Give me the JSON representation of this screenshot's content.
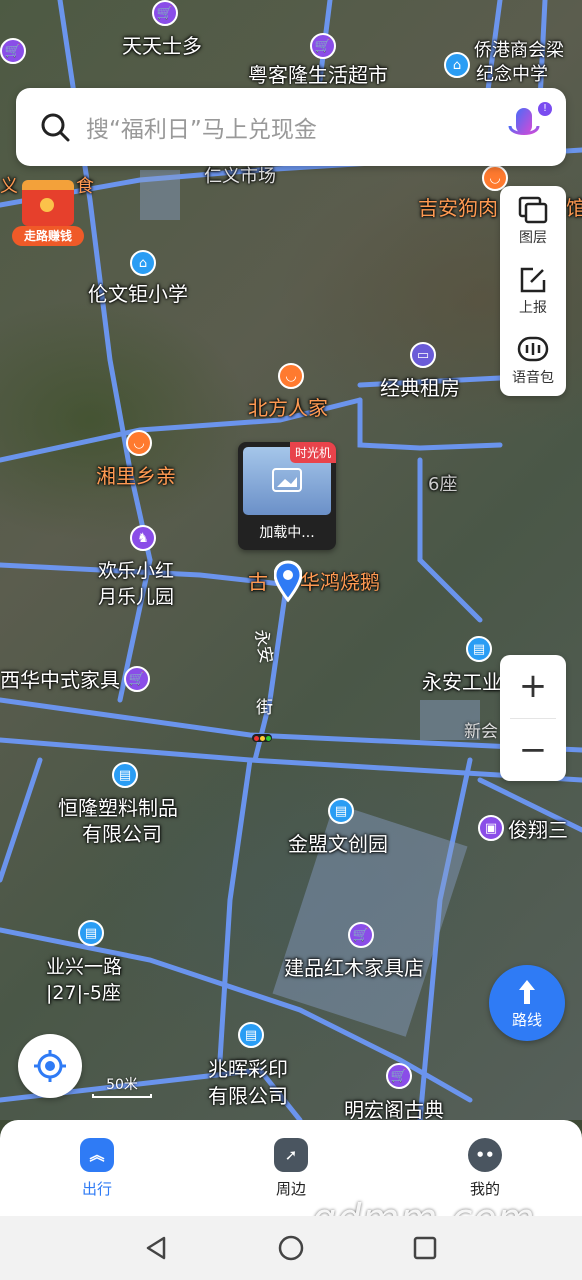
{
  "search": {
    "placeholder": "搜“福利日”马上兑现金"
  },
  "side_tools": [
    {
      "label": "图层",
      "icon": "layers-icon"
    },
    {
      "label": "上报",
      "icon": "report-edit-icon"
    },
    {
      "label": "语音包",
      "icon": "voice-pack-icon"
    }
  ],
  "zoom": {
    "in": "+",
    "out": "−"
  },
  "route_button": {
    "label": "路线"
  },
  "promo": {
    "label": "走路赚钱"
  },
  "timelapse": {
    "tag": "时光机",
    "status": "加载中..."
  },
  "scale": {
    "label": "50米"
  },
  "map_labels": {
    "l1": "天天士多",
    "l2": "粤客隆生活超市",
    "l3": "侨港商会梁",
    "l4": "纪念中学",
    "l5": "仁义市场",
    "l6": "义",
    "l7": "吉安狗肉",
    "l8": "伦文钜小学",
    "l9": "经典租房",
    "l10": "北方人家",
    "l11": "湘里乡亲",
    "l12": "6座",
    "l13": "欢乐小红",
    "l14": "月乐儿园",
    "l15": "古",
    "l16": "华鸿烧鹅",
    "l17": "永安",
    "l18": "街",
    "l19": "西华中式家具",
    "l20": "永安工业",
    "l21": "新会",
    "l22": "恒隆塑料制品",
    "l23": "有限公司",
    "l24": "俊翔三",
    "l25": "金盟文创园",
    "l26": "业兴一路",
    "l27": "|27|-5座",
    "l28": "建品红木家具店",
    "l29": "兆晖彩印",
    "l30": "有限公司",
    "l31": "明宏阁古典",
    "l32": "食",
    "l33": "馆"
  },
  "bottom_nav": [
    {
      "label": "出行",
      "active": true
    },
    {
      "label": "周边",
      "active": false
    },
    {
      "label": "我的",
      "active": false
    }
  ],
  "watermark": "gdmm.com",
  "colors": {
    "accent": "#2f7bf5",
    "road": "#6e9bff",
    "shop": "#8a4de8",
    "food": "#ff7a2f",
    "edu": "#2a9df4"
  }
}
